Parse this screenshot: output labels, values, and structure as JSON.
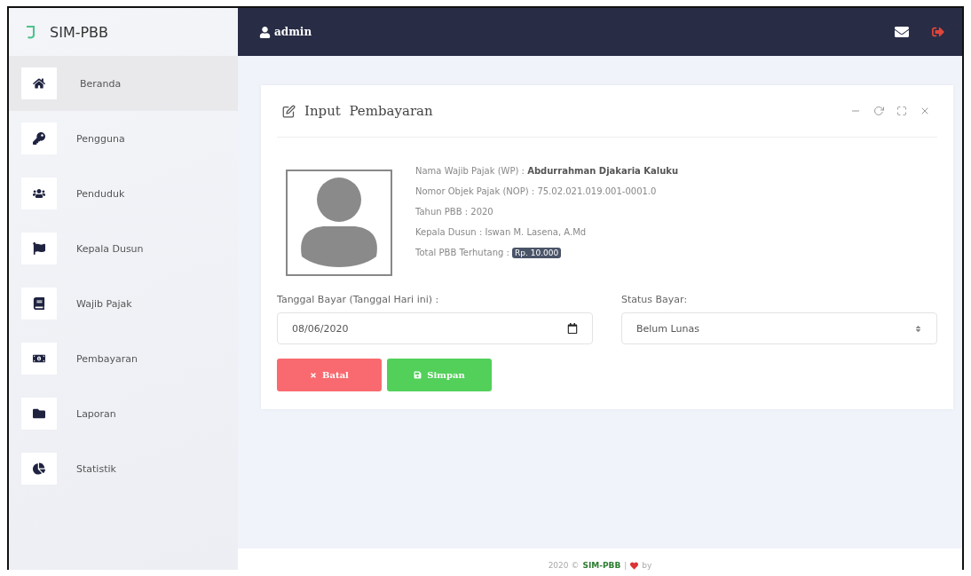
{
  "brand": {
    "title": "SIM-PBB"
  },
  "header": {
    "user": "admin"
  },
  "sidebar": {
    "items": [
      {
        "label": "Beranda",
        "selected": true
      },
      {
        "label": "Pengguna",
        "selected": false
      },
      {
        "label": "Penduduk",
        "selected": false
      },
      {
        "label": "Kepala Dusun",
        "selected": false
      },
      {
        "label": "Wajib Pajak",
        "selected": false
      },
      {
        "label": "Pembayaran",
        "selected": false
      },
      {
        "label": "Laporan",
        "selected": false
      },
      {
        "label": "Statistik",
        "selected": false
      }
    ]
  },
  "card": {
    "title": "Input  Pembayaran",
    "info": [
      {
        "label": "Nama Wajib Pajak (WP) : ",
        "value": "Abdurrahman Djakaria Kaluku",
        "kind": "bold"
      },
      {
        "label": "Nomor Objek Pajak (NOP) : ",
        "value": "75.02.021.019.001-0001.0",
        "kind": "plain"
      },
      {
        "label": "Tahun PBB : ",
        "value": "2020",
        "kind": "plain"
      },
      {
        "label": "Kepala Dusun : ",
        "value": "Iswan M. Lasena, A.Md",
        "kind": "plain"
      },
      {
        "label": "Total PBB Terhutang : ",
        "value": "Rp. 10.000",
        "kind": "badge"
      }
    ],
    "date_field": {
      "label": "Tanggal Bayar (Tanggal Hari ini) :",
      "value": "08/06/2020"
    },
    "status_field": {
      "label": "Status Bayar:",
      "value": "Belum Lunas"
    },
    "buttons": [
      {
        "label": "Batal",
        "kind": "cancel"
      },
      {
        "label": "Simpan",
        "kind": "save"
      }
    ]
  },
  "footer": {
    "year": "2020 ©",
    "brand": "SIM-PBB",
    "separator": "|",
    "by": "by"
  }
}
